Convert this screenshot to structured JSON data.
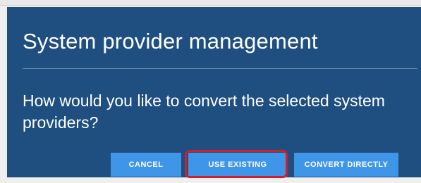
{
  "dialog": {
    "title": "System provider management",
    "message": "How would you like to convert the selected system providers?"
  },
  "buttons": {
    "cancel": "CANCEL",
    "use_existing": "USE EXISTING",
    "convert_directly": "CONVERT DIRECTLY"
  },
  "colors": {
    "dialog_background": "#1e4f80",
    "button_background": "#3f96e8",
    "highlight_border": "#d41d2a",
    "text": "#ffffff"
  }
}
